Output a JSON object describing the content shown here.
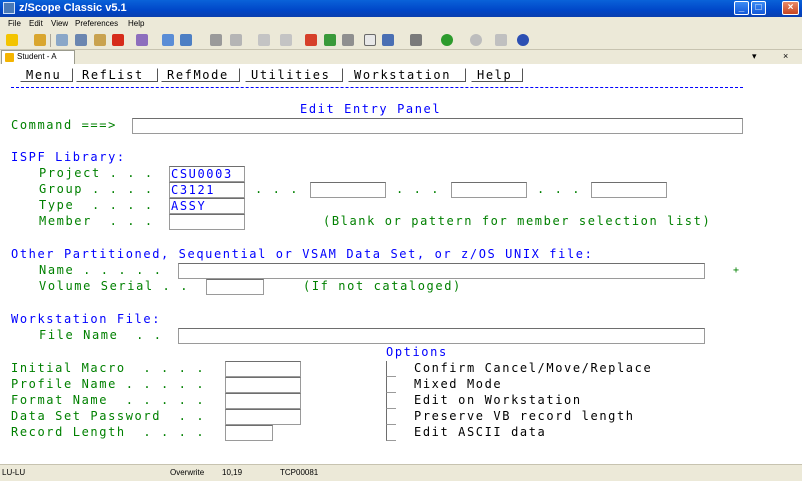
{
  "window": {
    "title": "z/Scope Classic v5.1"
  },
  "menu": [
    "File",
    "Edit",
    "View",
    "Preferences",
    "Help"
  ],
  "tab": {
    "label": "Student - A"
  },
  "ispf_menu": [
    "Menu",
    "RefList",
    "RefMode",
    "Utilities",
    "Workstation",
    "Help"
  ],
  "panel": {
    "title": "Edit Entry Panel",
    "command_label": "Command ===>",
    "command_value": "",
    "ispf_library": "ISPF Library:",
    "project_label": "Project . . .",
    "project_value": "CSU0003",
    "group_label": "Group . . . .",
    "group_value": "C3121",
    "group_dots1": ". . .",
    "group_dots2": ". . .",
    "group_dots3": ". . .",
    "type_label": "Type  . . . .",
    "type_value": "ASSY",
    "member_label": "Member  . . .",
    "member_hint": "(Blank or pattern for member selection list)",
    "other_label": "Other Partitioned, Sequential or VSAM Data Set, or z/OS UNIX file:",
    "name_label": "Name . . . . .",
    "name_plus": "+",
    "volume_label": "Volume Serial . .",
    "volume_hint": "(If not cataloged)",
    "workstation_label": "Workstation File:",
    "filename_label": "File Name  . .",
    "options_label": "Options",
    "initial_macro_label": "Initial Macro  . . . .",
    "profile_name_label": "Profile Name . . . . .",
    "format_name_label": "Format Name  . . . . .",
    "dsn_password_label": "Data Set Password  . .",
    "record_length_label": "Record Length  . . . .",
    "opt_confirm": "Confirm Cancel/Move/Replace",
    "opt_mixed": "Mixed Mode",
    "opt_edit_ws": "Edit on Workstation",
    "opt_preserve": "Preserve VB record length",
    "opt_ascii": "Edit ASCII data"
  },
  "status": {
    "lu": "LU-LU",
    "mode": "Overwrite",
    "cursor": "10,19",
    "device": "TCP00081"
  },
  "colors": {
    "field_text": "#0000ff",
    "label_text": "#008000",
    "title_bar": "#0a62d9"
  }
}
